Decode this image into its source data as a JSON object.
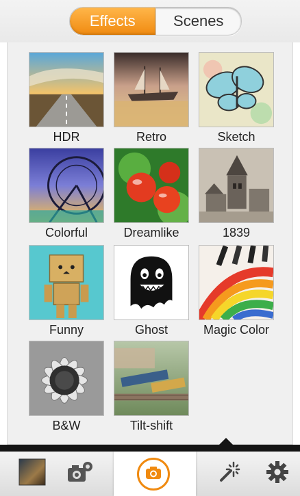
{
  "tabs": [
    {
      "label": "Effects",
      "active": true
    },
    {
      "label": "Scenes",
      "active": false
    }
  ],
  "effects": [
    {
      "label": "HDR",
      "icon": "hdr-road-thumbnail"
    },
    {
      "label": "Retro",
      "icon": "retro-ship-thumbnail"
    },
    {
      "label": "Sketch",
      "icon": "sketch-butterfly-thumbnail"
    },
    {
      "label": "Colorful",
      "icon": "colorful-ferris-wheel-thumbnail"
    },
    {
      "label": "Dreamlike",
      "icon": "dreamlike-tomatoes-thumbnail"
    },
    {
      "label": "1839",
      "icon": "1839-church-thumbnail"
    },
    {
      "label": "Funny",
      "icon": "funny-box-robot-thumbnail"
    },
    {
      "label": "Ghost",
      "icon": "ghost-thumbnail"
    },
    {
      "label": "Magic Color",
      "icon": "magic-color-pencils-thumbnail"
    },
    {
      "label": "B&W",
      "icon": "bw-sunflower-thumbnail"
    },
    {
      "label": "Tilt-shift",
      "icon": "tilt-shift-train-thumbnail"
    }
  ],
  "bottombar": {
    "gallery_icon": "gallery-thumbnail-icon",
    "camera_settings_icon": "camera-gear-icon",
    "shutter_icon": "camera-shutter-icon",
    "effects_icon": "magic-wand-icon",
    "settings_icon": "settings-gear-icon"
  },
  "colors": {
    "accent": "#f08a10",
    "bar": "#141414"
  }
}
